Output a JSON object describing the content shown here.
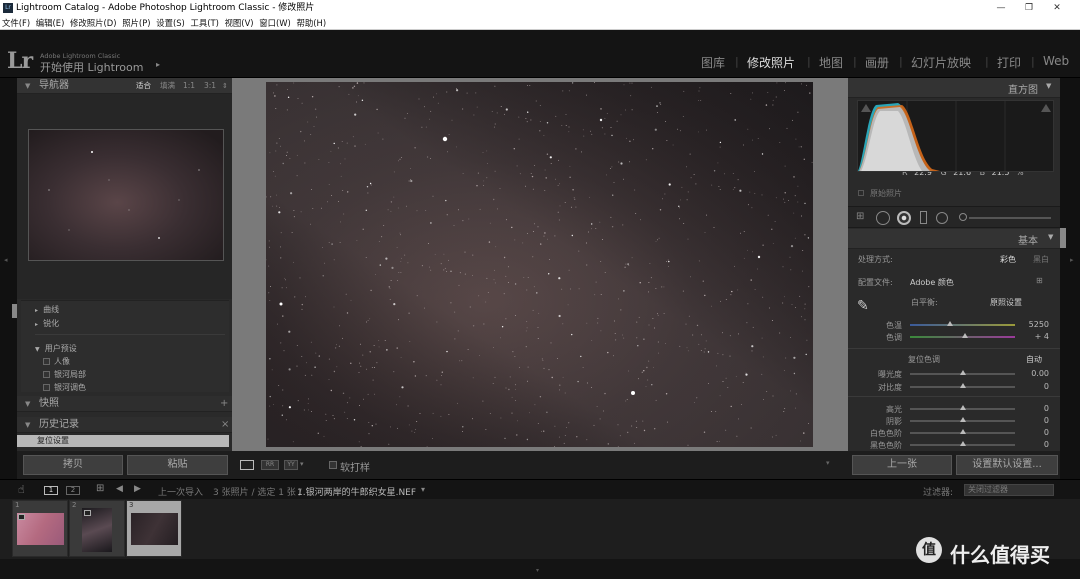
{
  "window": {
    "title": "Lightroom Catalog - Adobe Photoshop Lightroom Classic - 修改照片",
    "icon_label": "Lr"
  },
  "menu": [
    "文件(F)",
    "编辑(E)",
    "修改照片(D)",
    "照片(P)",
    "设置(S)",
    "工具(T)",
    "视图(V)",
    "窗口(W)",
    "帮助(H)"
  ],
  "brand": {
    "logo": "Lr",
    "small": "Adobe Lightroom Classic",
    "start": "开始使用 Lightroom",
    "arrow": "▸"
  },
  "modules": [
    {
      "label": "图库",
      "active": false
    },
    {
      "label": "修改照片",
      "active": true
    },
    {
      "label": "地图",
      "active": false
    },
    {
      "label": "画册",
      "active": false
    },
    {
      "label": "幻灯片放映",
      "active": false
    },
    {
      "label": "打印",
      "active": false
    },
    {
      "label": "Web",
      "active": false
    }
  ],
  "navigator": {
    "title": "导航器",
    "zoom": [
      "适合",
      "填满",
      "1:1",
      "3:1"
    ]
  },
  "presets": {
    "collapsed": [
      "曲线",
      "锐化"
    ],
    "user_group": "用户预设",
    "items": [
      "人像",
      "银河局部",
      "银河调色"
    ]
  },
  "snapshots": {
    "title": "快照",
    "add": "+"
  },
  "history": {
    "title": "历史记录",
    "close": "×",
    "items": [
      "复位设置"
    ]
  },
  "left_buttons": {
    "copy": "拷贝",
    "paste": "粘贴"
  },
  "center_toolbar": {
    "softproof": "软打样"
  },
  "histogram": {
    "title": "直方图",
    "r_label": "R",
    "r": "22.9",
    "g_label": "G",
    "g": "21.6",
    "b_label": "B",
    "b": "21.5",
    "unit": "%",
    "original": "原始照片"
  },
  "basic": {
    "title": "基本",
    "treatment_label": "处理方式:",
    "treatment_color": "彩色",
    "treatment_bw": "黑白",
    "profile_label": "配置文件:",
    "profile_value": "Adobe 颜色",
    "wb_label": "白平衡:",
    "wb_value": "原照设置",
    "temp_label": "色温",
    "temp_value": "5250",
    "temp_level": 0.38,
    "tint_label": "色调",
    "tint_value": "+ 4",
    "tint_level": 0.52,
    "tone_label": "复位色调",
    "auto": "自动",
    "exposure_label": "曝光度",
    "exposure_value": "0.00",
    "contrast_label": "对比度",
    "contrast_value": "0",
    "highlights_label": "高光",
    "highlights_value": "0",
    "shadows_label": "阴影",
    "shadows_value": "0",
    "whites_label": "白色色阶",
    "whites_value": "0",
    "blacks_label": "黑色色阶",
    "blacks_value": "0"
  },
  "right_buttons": {
    "prev": "上一张",
    "default": "设置默认设置..."
  },
  "filmbar": {
    "page1": "1",
    "page2": "2",
    "prev_import": "上一次导入",
    "count": "3 张照片 / 选定 1 张 /",
    "filename": "1.银河两岸的牛郎织女星.NEF",
    "dropdown_arrow": "▾",
    "filter_label": "过滤器:",
    "filter_value": "关闭过滤器"
  },
  "thumbs": [
    {
      "num": "1"
    },
    {
      "num": "2"
    },
    {
      "num": "3"
    }
  ],
  "watermark": {
    "icon": "值",
    "text": "什么值得买"
  }
}
